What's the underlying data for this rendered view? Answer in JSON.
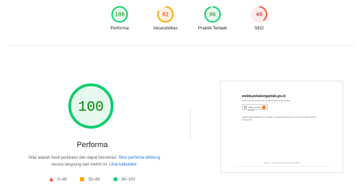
{
  "summary": [
    {
      "score": "100",
      "label": "Performa",
      "color": "#0cce6b",
      "bg": "#e6f9ef",
      "text": "#008800",
      "fraction": 1.0
    },
    {
      "score": "82",
      "label": "Aksesibilitas",
      "color": "#ffa400",
      "bg": "#fff3e0",
      "text": "#c33300",
      "fraction": 0.82
    },
    {
      "score": "96",
      "label": "Praktik Terbaik",
      "color": "#0cce6b",
      "bg": "#e6f9ef",
      "text": "#008800",
      "fraction": 0.96
    },
    {
      "score": "40",
      "label": "SEO",
      "color": "#ff4e42",
      "bg": "#fdeceb",
      "text": "#cc0000",
      "fraction": 0.4
    }
  ],
  "main": {
    "score": "100",
    "fraction": 1.0,
    "title": "Performa",
    "desc_text1": "Nilai adalah hasil perkiraan dan dapat bervariasi. ",
    "desc_link1": "Skor performa dihitung",
    "desc_text2": "secara langsung dari metrik ini. ",
    "desc_link2": "Lihat kalkulator."
  },
  "legend": {
    "fail": "0–49",
    "average": "50–89",
    "pass": "90–100"
  },
  "thumbnail": {
    "domain": "welda.pekalonganlab.go.id",
    "line1": "Verify you are human by completing the action below.",
    "captcha_label": "Verify you are human",
    "para": "welda.pekalonganlab.go.id needs to review the security of your connection before proceeding.",
    "footer": "Ray ID: · Performance & security by Cloudflare"
  },
  "colors": {
    "pass": "#0cce6b",
    "average": "#ffa400",
    "fail": "#ff4e42",
    "link": "#1a73e8"
  }
}
